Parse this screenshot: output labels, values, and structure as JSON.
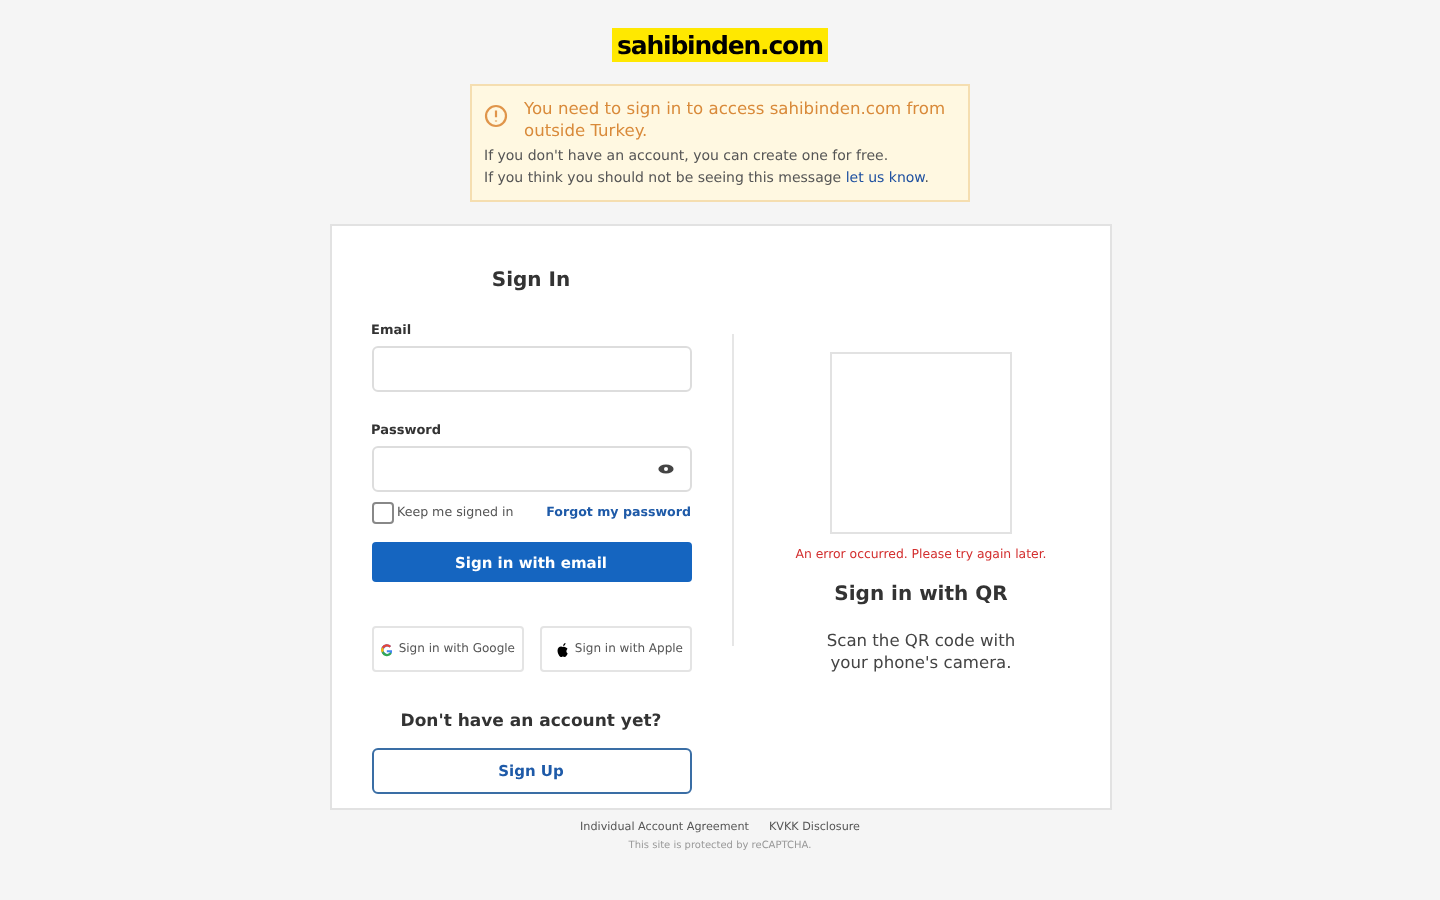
{
  "logo": "sahibinden.com",
  "alert": {
    "title": "You need to sign in to access sahibinden.com from outside Turkey.",
    "line1": "If you don't have an account, you can create one for free.",
    "line2": "If you think you should not be seeing this message",
    "link": "let us know",
    "end": "."
  },
  "signin": {
    "title": "Sign In",
    "email_label": "Email",
    "password_label": "Password",
    "keep_signed_in": {
      "label": "Keep me signed in",
      "checked": false
    },
    "forgot": "Forgot my password",
    "submit": "Sign in with email",
    "social": [
      {
        "kind": "google",
        "label": "Sign in with Google"
      },
      {
        "kind": "apple",
        "label": "Sign in with Apple"
      }
    ],
    "no_account": "Don't have an account yet?",
    "signup": "Sign Up"
  },
  "qr": {
    "error": "An error occurred. Please try again later.",
    "title": "Sign in with QR",
    "text": "Scan the QR code with your phone's camera."
  },
  "footer": {
    "links": [
      "Individual Account Agreement",
      "KVKK Disclosure"
    ],
    "note": "This site is protected by reCAPTCHA."
  }
}
